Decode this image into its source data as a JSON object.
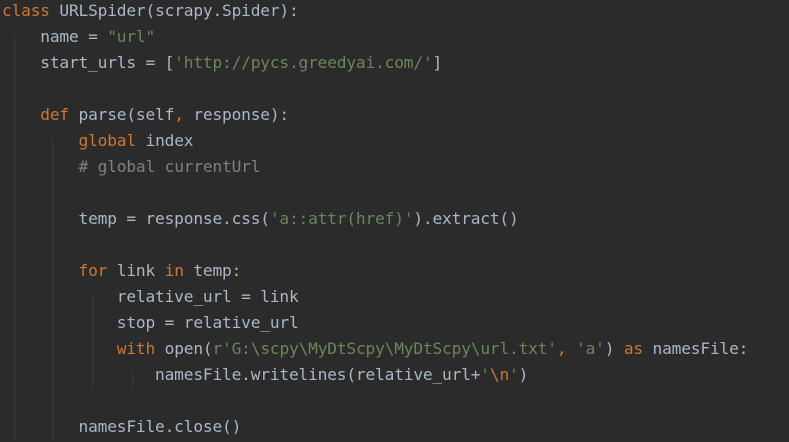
{
  "colors": {
    "background": "#2b2b2b",
    "keyword": "#cc7832",
    "normal": "#a9b7c6",
    "string": "#6a8759",
    "comment": "#808080",
    "escape": "#cc7832",
    "indent_guide": "#3b3b3b"
  },
  "lines": [
    {
      "tokens": [
        {
          "t": "keyword",
          "v": "class "
        },
        {
          "t": "normal",
          "v": "URLSpider(scrapy.Spider):"
        }
      ]
    },
    {
      "tokens": [
        {
          "t": "normal",
          "v": "    name = "
        },
        {
          "t": "string",
          "v": "\"url\""
        }
      ]
    },
    {
      "tokens": [
        {
          "t": "normal",
          "v": "    start_urls = ["
        },
        {
          "t": "string",
          "v": "'http://pycs.greedyai.com/'"
        },
        {
          "t": "normal",
          "v": "]"
        }
      ]
    },
    {
      "tokens": []
    },
    {
      "tokens": [
        {
          "t": "normal",
          "v": "    "
        },
        {
          "t": "keyword",
          "v": "def "
        },
        {
          "t": "normal",
          "v": "parse(self"
        },
        {
          "t": "keyword",
          "v": ", "
        },
        {
          "t": "normal",
          "v": "response):"
        }
      ]
    },
    {
      "tokens": [
        {
          "t": "normal",
          "v": "        "
        },
        {
          "t": "keyword",
          "v": "global "
        },
        {
          "t": "normal",
          "v": "index"
        }
      ]
    },
    {
      "tokens": [
        {
          "t": "normal",
          "v": "        "
        },
        {
          "t": "comment",
          "v": "# global currentUrl"
        }
      ]
    },
    {
      "tokens": []
    },
    {
      "tokens": [
        {
          "t": "normal",
          "v": "        temp = response.css("
        },
        {
          "t": "string",
          "v": "'a::attr(href)'"
        },
        {
          "t": "normal",
          "v": ").extract()"
        }
      ]
    },
    {
      "tokens": []
    },
    {
      "tokens": [
        {
          "t": "normal",
          "v": "        "
        },
        {
          "t": "keyword",
          "v": "for "
        },
        {
          "t": "normal",
          "v": "link "
        },
        {
          "t": "keyword",
          "v": "in "
        },
        {
          "t": "normal",
          "v": "temp:"
        }
      ]
    },
    {
      "tokens": [
        {
          "t": "normal",
          "v": "            relative_url = link"
        }
      ]
    },
    {
      "tokens": [
        {
          "t": "normal",
          "v": "            stop = relative_url"
        }
      ]
    },
    {
      "tokens": [
        {
          "t": "normal",
          "v": "            "
        },
        {
          "t": "keyword",
          "v": "with "
        },
        {
          "t": "normal",
          "v": "open("
        },
        {
          "t": "string",
          "v": "r'G:\\scpy\\MyDtScpy\\MyDtScpy\\url.txt'"
        },
        {
          "t": "keyword",
          "v": ", "
        },
        {
          "t": "string",
          "v": "'a'"
        },
        {
          "t": "normal",
          "v": ") "
        },
        {
          "t": "keyword",
          "v": "as "
        },
        {
          "t": "normal",
          "v": "namesFile:"
        }
      ]
    },
    {
      "tokens": [
        {
          "t": "normal",
          "v": "                namesFile.writelines(relative_url+"
        },
        {
          "t": "string",
          "v": "'"
        },
        {
          "t": "escape",
          "v": "\\n"
        },
        {
          "t": "string",
          "v": "'"
        },
        {
          "t": "normal",
          "v": ")"
        }
      ]
    },
    {
      "tokens": []
    },
    {
      "tokens": [
        {
          "t": "normal",
          "v": "        namesFile.close()"
        }
      ]
    }
  ]
}
